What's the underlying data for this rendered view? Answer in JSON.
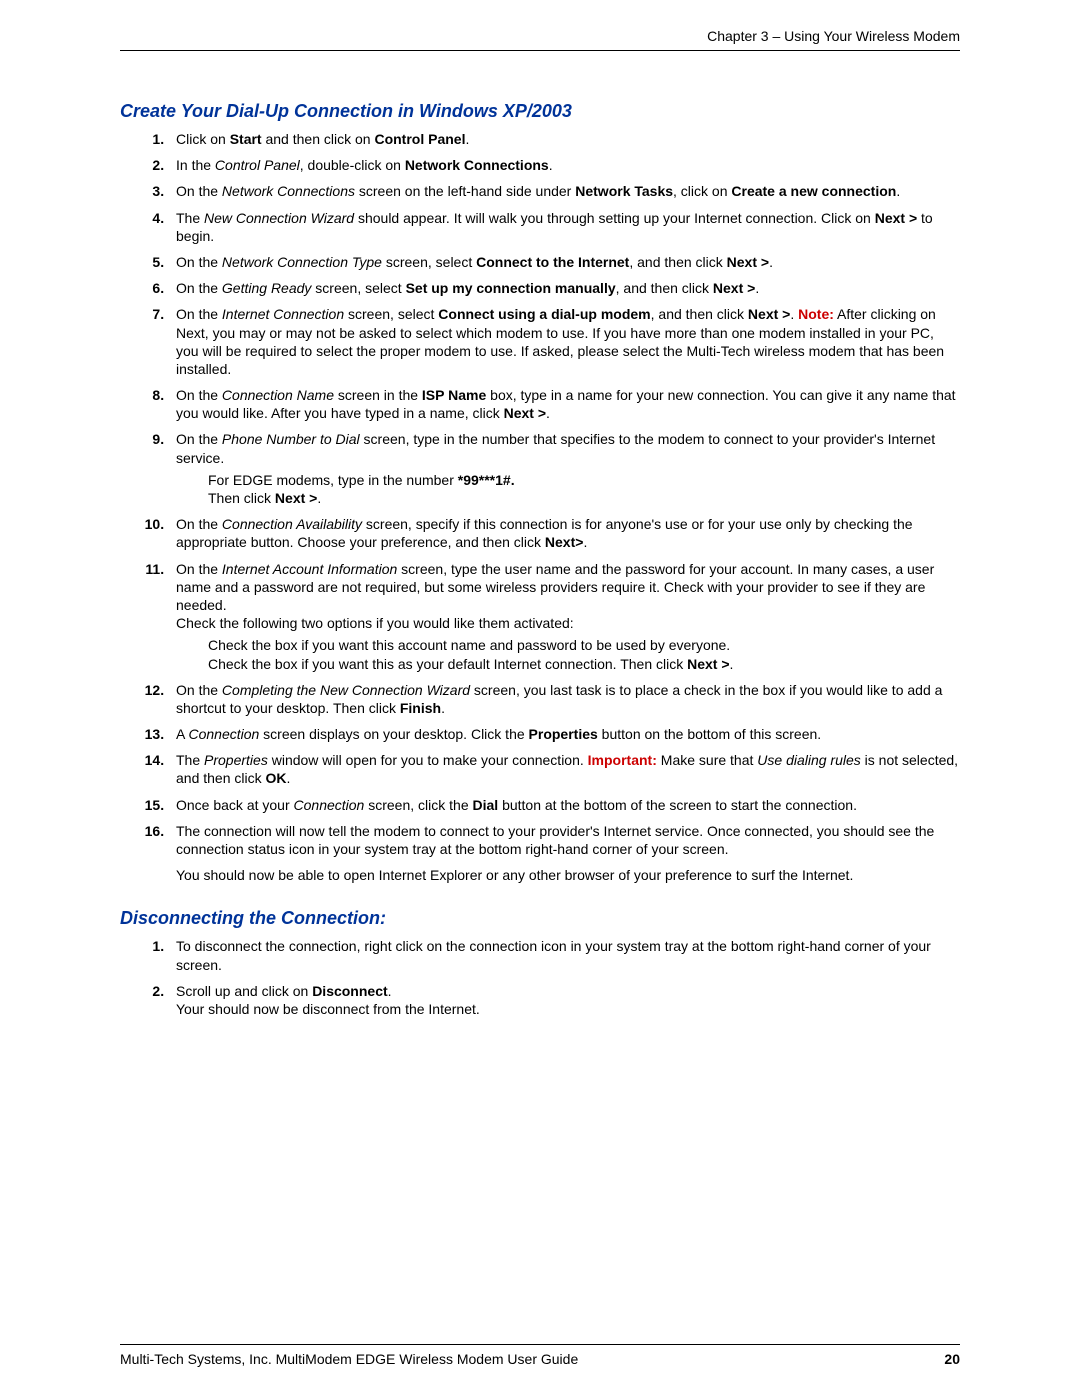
{
  "header": "Chapter 3 – Using Your Wireless Modem",
  "section1": {
    "title": "Create Your Dial-Up Connection in Windows XP/2003",
    "s1_a": "Click on ",
    "s1_b": "Start",
    "s1_c": " and then click on ",
    "s1_d": "Control Panel",
    "s1_e": ".",
    "s2_a": "In the ",
    "s2_b": "Control Panel",
    "s2_c": ", double-click on ",
    "s2_d": "Network Connections",
    "s2_e": ".",
    "s3_a": "On the ",
    "s3_b": "Network Connections",
    "s3_c": " screen on the left-hand side under ",
    "s3_d": "Network Tasks",
    "s3_e": ", click on ",
    "s3_f": "Create a new connection",
    "s3_g": ".",
    "s4_a": "The ",
    "s4_b": "New Connection Wizard",
    "s4_c": " should appear. It will walk you through setting up your Internet connection. Click on ",
    "s4_d": "Next >",
    "s4_e": " to begin.",
    "s5_a": "On the ",
    "s5_b": "Network Connection Type",
    "s5_c": " screen, select ",
    "s5_d": "Connect to the Internet",
    "s5_e": ", and then click ",
    "s5_f": "Next >",
    "s5_g": ".",
    "s6_a": "On the ",
    "s6_b": "Getting Ready",
    "s6_c": " screen, select ",
    "s6_d": "Set up my connection manually",
    "s6_e": ", and then click ",
    "s6_f": "Next >",
    "s6_g": ".",
    "s7_a": "On the ",
    "s7_b": "Internet Connection",
    "s7_c": " screen, select ",
    "s7_d": "Connect using a dial-up modem",
    "s7_e": ", and then click ",
    "s7_f": "Next >",
    "s7_g": ". ",
    "s7_note": "Note:",
    "s7_h": " After clicking on Next, you may or may not be asked to select which modem to use. If you have more than one modem installed in your PC, you will be required to select the proper modem to use. If asked, please select the Multi-Tech wireless modem that has been installed.",
    "s8_a": "On the ",
    "s8_b": "Connection Name",
    "s8_c": " screen in the ",
    "s8_d": "ISP Name",
    "s8_e": " box, type in a name for your new connection. You can give it any name that you would like. After you have typed in a name, click ",
    "s8_f": "Next >",
    "s8_g": ".",
    "s9_a": "On the ",
    "s9_b": "Phone Number to Dial",
    "s9_c": " screen, type in the number that specifies to the modem to connect to your provider's Internet service.",
    "s9_sub1_a": "For EDGE modems, type in the number ",
    "s9_sub1_b": "*99***1#.",
    "s9_sub2_a": "Then click ",
    "s9_sub2_b": "Next >",
    "s9_sub2_c": ".",
    "s10_a": "On the ",
    "s10_b": "Connection Availability",
    "s10_c": " screen, specify if this connection is for anyone's use or for your use only by checking the appropriate button. Choose your preference, and then click ",
    "s10_d": "Next>",
    "s10_e": ".",
    "s11_a": "On the ",
    "s11_b": "Internet Account Information",
    "s11_c": " screen, type the user name and the password for your account. In many cases, a user name and a password are not required, but some wireless providers require it. Check with your provider to see if they are needed.",
    "s11_d": "Check the following two options if you would like them activated:",
    "s11_sub1": "Check the box if you want this account name and password to be used by everyone.",
    "s11_sub2_a": "Check the box if you want this as your default Internet connection. Then click ",
    "s11_sub2_b": "Next >",
    "s11_sub2_c": ".",
    "s12_a": "On the ",
    "s12_b": "Completing the New Connection Wizard",
    "s12_c": " screen, you last task is to place a check in the box if you would like to add a shortcut to your desktop. Then click ",
    "s12_d": "Finish",
    "s12_e": ".",
    "s13_a": "A ",
    "s13_b": "Connection",
    "s13_c": " screen displays on your desktop. Click the ",
    "s13_d": "Properties",
    "s13_e": " button on the bottom of this screen.",
    "s14_a": "The ",
    "s14_b": "Properties",
    "s14_c": " window will open for you to make your connection. ",
    "s14_important": "Important:",
    "s14_d": " Make sure that ",
    "s14_e": "Use dialing rules",
    "s14_f": " is not selected, and then click ",
    "s14_g": "OK",
    "s14_h": ".",
    "s15_a": "Once back at your ",
    "s15_b": "Connection",
    "s15_c": " screen, click the ",
    "s15_d": "Dial",
    "s15_e": " button at the bottom of the screen to start the connection.",
    "s16_a": "The connection will now tell the modem to connect to your provider's Internet service. Once connected, you should see the connection status icon in your system tray at the bottom right-hand corner of your screen.",
    "s16_b": "You should now be able to open Internet Explorer or any other browser of your preference to surf the Internet."
  },
  "section2": {
    "title": "Disconnecting the Connection:",
    "s1": "To disconnect the connection, right click on the connection icon in your system tray at the bottom right-hand corner of your screen.",
    "s2_a": "Scroll up and click on ",
    "s2_b": "Disconnect",
    "s2_c": ".",
    "s2_d": "Your should now be disconnect from the Internet."
  },
  "footer": {
    "left": "Multi-Tech Systems, Inc. MultiModem EDGE Wireless Modem User Guide",
    "right": "20"
  }
}
